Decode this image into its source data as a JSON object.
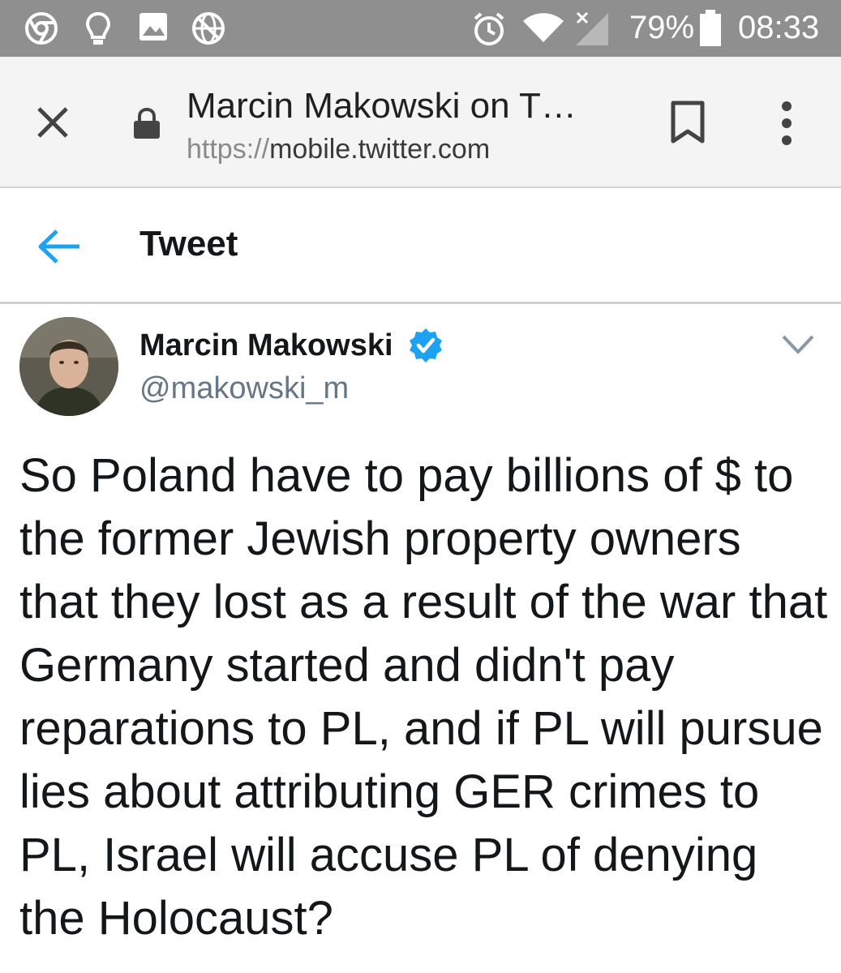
{
  "status_bar": {
    "battery": "79%",
    "time": "08:33",
    "icons": [
      "chrome-icon",
      "lightbulb-icon",
      "image-icon",
      "vpn-globe-icon",
      "alarm-icon",
      "wifi-icon",
      "no-signal-icon",
      "battery-icon"
    ],
    "background": "#8f8f8f"
  },
  "browser": {
    "page_title": "Marcin Makowski on T…",
    "url_scheme": "https://",
    "url_host": "mobile.twitter.com"
  },
  "header": {
    "title": "Tweet",
    "accent": "#1da1f2"
  },
  "tweet": {
    "author_name": "Marcin Makowski",
    "author_handle": "@makowski_m",
    "verified": true,
    "text": "So Poland have to pay billions of $ to the former Jewish property owners that they lost as a result of the war that Germany started and didn't pay reparations to PL, and if PL will pursue lies about attributing GER crimes to PL, Israel will accuse PL of denying the Holocaust?"
  }
}
